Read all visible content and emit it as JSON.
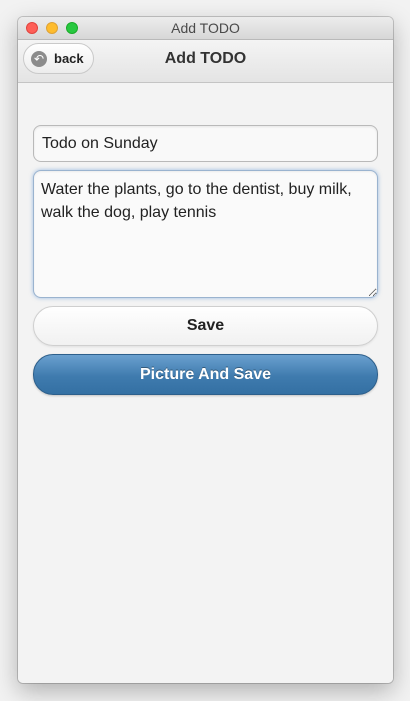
{
  "window": {
    "title": "Add TODO"
  },
  "navbar": {
    "back_label": "back",
    "back_icon": "back-arrow-icon",
    "title": "Add TODO"
  },
  "form": {
    "title_value": "Todo on Sunday",
    "body_value": "Water the plants, go to the dentist, buy milk, walk the dog, play tennis",
    "save_label": "Save",
    "picture_save_label": "Picture And Save"
  },
  "colors": {
    "primary_button": "#3f7bae",
    "close": "#fe5f57",
    "minimize": "#febc2e",
    "maximize": "#28c840"
  }
}
